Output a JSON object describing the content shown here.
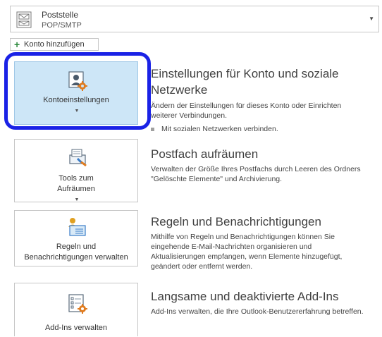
{
  "account": {
    "name": "Poststelle",
    "type": "POP/SMTP"
  },
  "add_account_label": "Konto hinzufügen",
  "buttons": {
    "account_settings": {
      "line1": "Kontoeinstellungen"
    },
    "cleanup": {
      "line1": "Tools zum",
      "line2": "Aufräumen"
    },
    "rules": {
      "line1": "Regeln und",
      "line2": "Benachrichtigungen verwalten"
    },
    "addins": {
      "line1": "Add-Ins verwalten"
    }
  },
  "sections": {
    "account": {
      "title_line1": "Einstellungen für Konto und soziale",
      "title_line2": "Netzwerke",
      "desc_line1": "Ändern der Einstellungen für dieses Konto oder Einrichten",
      "desc_line2": "weiterer Verbindungen.",
      "bullet": "Mit sozialen Netzwerken verbinden."
    },
    "cleanup": {
      "title": "Postfach aufräumen",
      "desc_line1": "Verwalten der Größe Ihres Postfachs durch Leeren des Ordners",
      "desc_line2": "\"Gelöschte Elemente\" und Archivierung."
    },
    "rules": {
      "title": "Regeln und Benachrichtigungen",
      "desc_line1": "Mithilfe von Regeln und Benachrichtigungen können Sie",
      "desc_line2": "eingehende E-Mail-Nachrichten organisieren und",
      "desc_line3": "Aktualisierungen empfangen, wenn Elemente hinzugefügt,",
      "desc_line4": "geändert oder entfernt werden."
    },
    "addins": {
      "title": "Langsame und deaktivierte Add-Ins",
      "desc_line1": "Add-Ins verwalten, die Ihre Outlook-Benutzererfahrung betreffen."
    }
  },
  "colors": {
    "highlight": "#1a22e6",
    "selected_button": "#cde6f7",
    "icon_orange": "#e07b1e",
    "icon_blue": "#3a7dc9"
  }
}
